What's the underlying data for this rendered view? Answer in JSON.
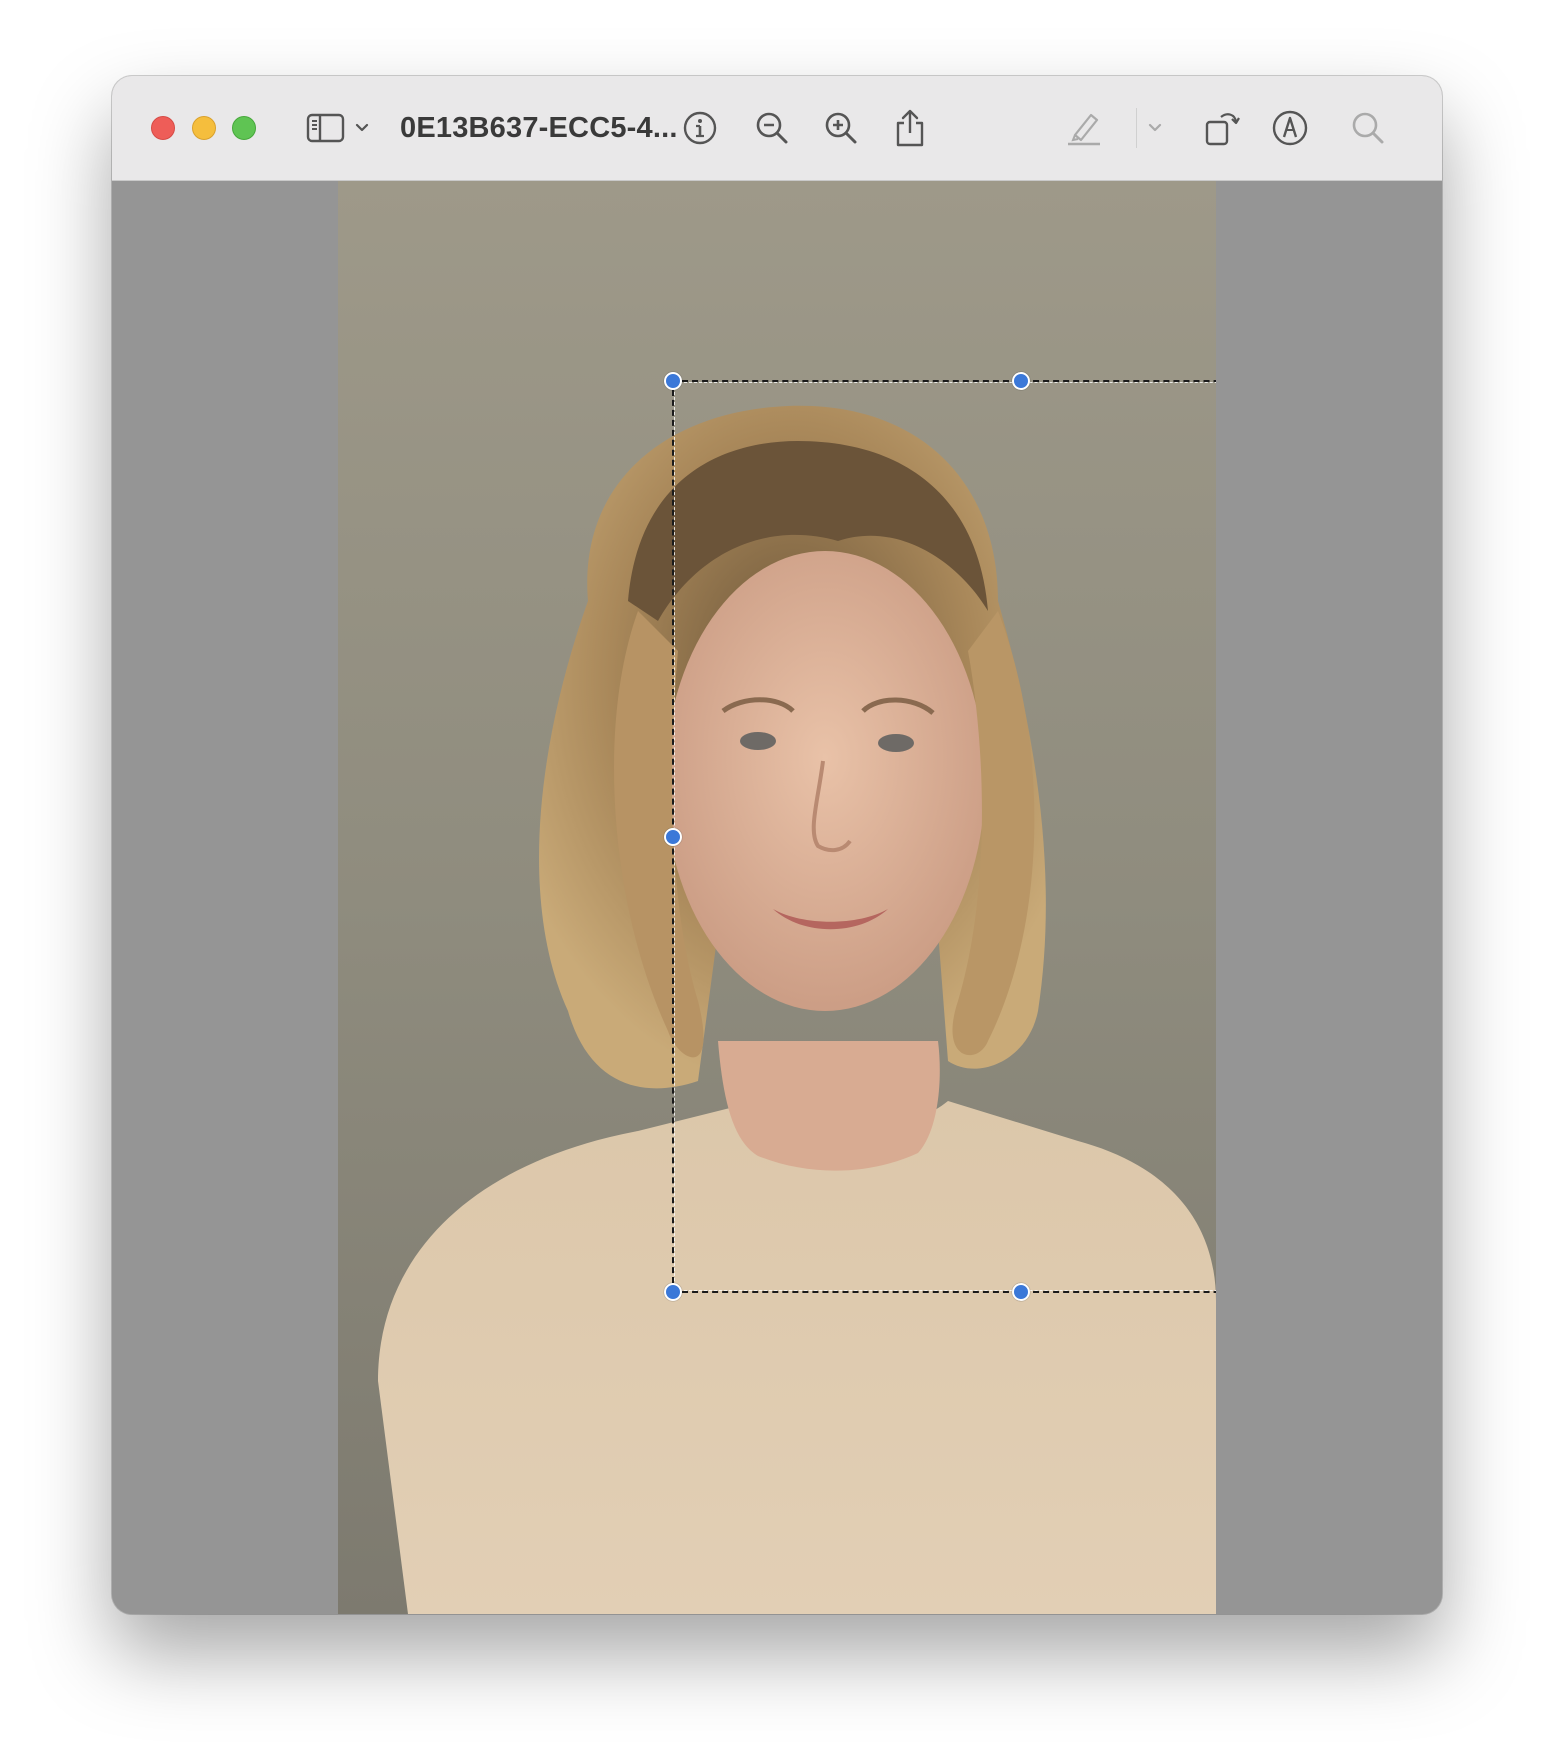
{
  "window": {
    "title": "0E13B637-ECC5-4..."
  },
  "toolbar": {
    "traffic_lights": [
      "close",
      "minimize",
      "zoom"
    ],
    "icons": [
      "sidebar-toggle-icon",
      "chevron-down-icon",
      "info-icon",
      "zoom-out-icon",
      "zoom-in-icon",
      "share-icon",
      "highlight-pen-icon",
      "chevron-down-icon",
      "rotate-icon",
      "markup-icon",
      "search-icon"
    ]
  },
  "colors": {
    "titlebar": "#e9e8e9",
    "canvas": "#959595",
    "selection_handle": "#3b78d8"
  },
  "image": {
    "content": "portrait photo of a woman with shoulder-length wavy blonde hair in a beige sweater against a grey wall"
  }
}
